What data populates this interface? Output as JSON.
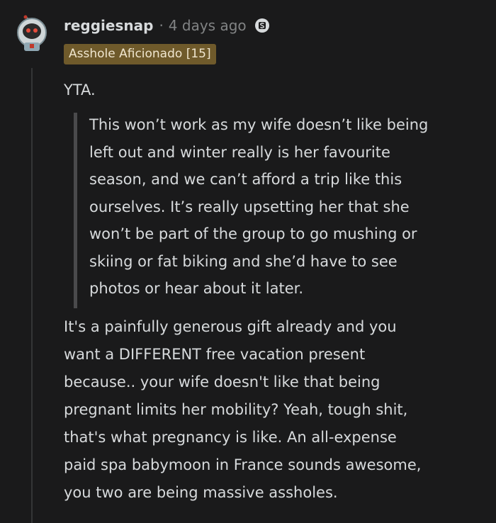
{
  "comment": {
    "username": "reggiesnap",
    "separator": "·",
    "time": "4 days ago",
    "flair": "Asshole Aficionado [15]",
    "verdict": "YTA.",
    "quote": "This won’t work as my wife doesn’t like being\nleft out and winter really is her favourite\nseason, and we can’t afford a trip like this\nourselves. It’s really upsetting her that she\nwon’t be part of the group to go mushing or\nskiing or fat biking and she’d have to see\nphotos or hear about it later.",
    "reply": "It's a painfully generous gift already and you\nwant a DIFFERENT free vacation present\nbecause.. your wife doesn't like that being\npregnant limits her mobility? Yeah, tough shit,\nthat's what pregnancy is like. An all-expense\npaid spa babymoon in France sounds awesome,\nyou two are being massive assholes."
  },
  "icons": {
    "avatar": "snoo-astronaut-avatar",
    "badge": "s-badge-icon"
  },
  "colors": {
    "background": "#1a1a1b",
    "text": "#d7dadc",
    "muted": "#818384",
    "flair_bg": "#6f5a2b",
    "quote_bar": "#4a4a4c"
  }
}
